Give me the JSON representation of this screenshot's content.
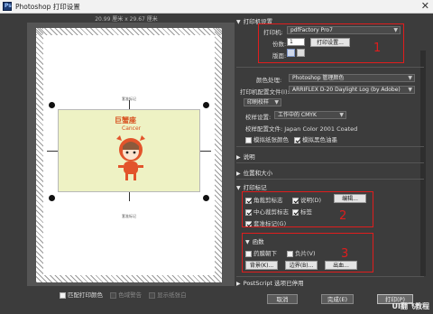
{
  "window": {
    "title": "Photoshop 打印设置",
    "close_glyph": "✕",
    "logo": "Ps"
  },
  "preview": {
    "ruler_text": "20.99 厘米 x 29.67 厘米",
    "label_top": "套准标记",
    "label_bottom": "套准标记",
    "artwork_title_cn": "巨蟹座",
    "artwork_title_en": "Cancer"
  },
  "bottom_left": {
    "match_colors": "匹配打印颜色",
    "gamut_warning": "色域警告",
    "show_paper_white": "显示纸张白"
  },
  "printer_section": {
    "header": "打印机设置",
    "printer_label": "打印机:",
    "printer_value": "pdfFactory Pro7",
    "copies_label": "份数:",
    "copies_value": "1",
    "print_settings_btn": "打印设置...",
    "layout_label": "版面:",
    "annotation_number": "1"
  },
  "color_section": {
    "color_handling_label": "颜色处理:",
    "color_handling_value": "Photoshop 管理颜色",
    "printer_profile_label": "打印机配置文件(I):",
    "printer_profile_value": "ARRIFLEX D-20 Daylight Log (by Adobe)",
    "mode_value": "印刷校样",
    "proof_setup_label": "校样设置:",
    "proof_setup_value": "工作中的 CMYK",
    "proof_profile_text": "校样配置文件: Japan Color 2001 Coated",
    "simulate_paper": "模拟纸张颜色",
    "simulate_black": "模拟黑色油墨"
  },
  "collapsed": {
    "description": "说明",
    "position_size": "位置和大小",
    "print_marks": "打印标记"
  },
  "marks_section": {
    "corner_crop": "角裁剪标志",
    "description": "说明(D)",
    "edit_btn": "编辑...",
    "center_crop": "中心裁剪标志",
    "labels": "标签",
    "registration": "套准标记(G)",
    "annotation_number": "2"
  },
  "functions_section": {
    "header": "函数",
    "emulsion_down": "药膜朝下",
    "negative": "负片(V)",
    "background_btn": "背景(K)...",
    "border_btn": "边界(B)...",
    "bleed_btn": "出血...",
    "annotation_number": "3"
  },
  "postscript": {
    "label": "PostScript 选项已停用"
  },
  "buttons": {
    "cancel": "取消",
    "done": "完成(E)",
    "print": "打印(P)"
  },
  "watermark": "UI翻飞教程"
}
